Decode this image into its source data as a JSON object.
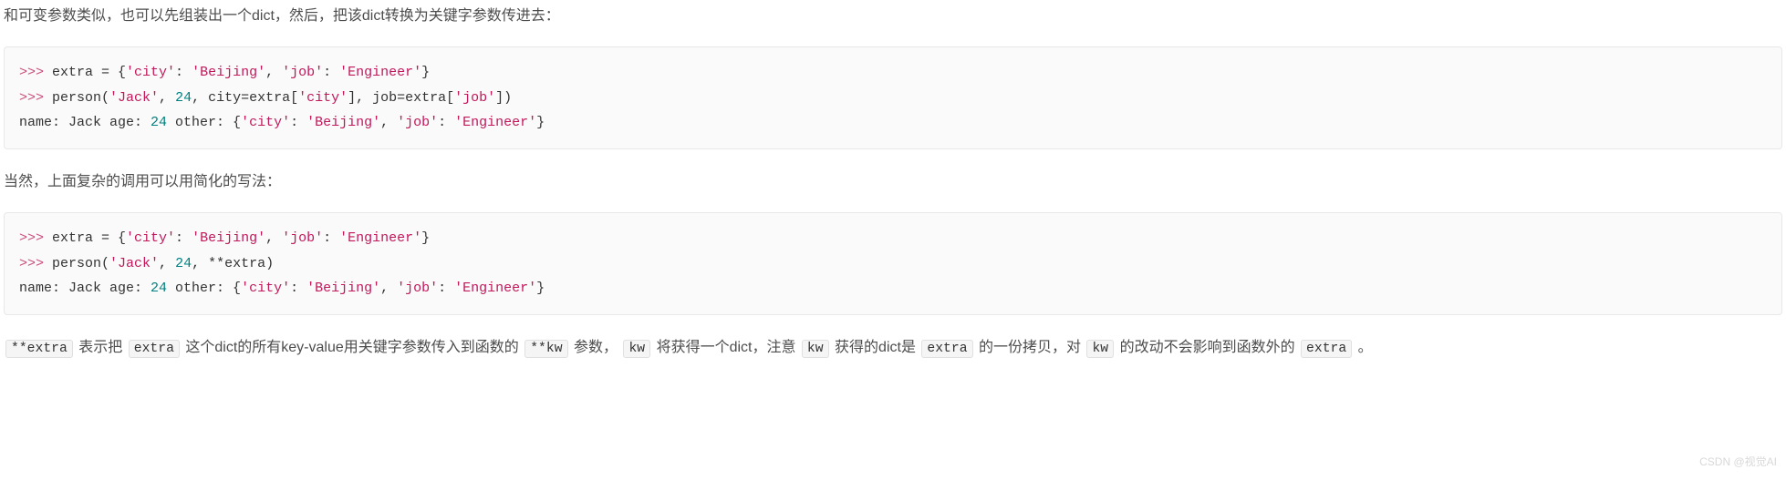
{
  "para1": "和可变参数类似，也可以先组装出一个dict，然后，把该dict转换为关键字参数传进去：",
  "para2": "当然，上面复杂的调用可以用简化的写法：",
  "code1": {
    "l1": {
      "prompt": ">>>",
      "t1": " extra = {",
      "s1": "'city'",
      "t2": ": ",
      "s2": "'Beijing'",
      "t3": ", ",
      "s3": "'job'",
      "t4": ": ",
      "s4": "'Engineer'",
      "t5": "}"
    },
    "l2": {
      "prompt": ">>>",
      "t1": " person(",
      "s1": "'Jack'",
      "t2": ", ",
      "n1": "24",
      "t3": ", city=extra[",
      "s2": "'city'",
      "t4": "], job=extra[",
      "s3": "'job'",
      "t5": "])"
    },
    "l3": {
      "t1": "name: Jack age: ",
      "n1": "24",
      "t2": " other: {",
      "s1": "'city'",
      "t3": ": ",
      "s2": "'Beijing'",
      "t4": ", ",
      "s3": "'job'",
      "t5": ": ",
      "s4": "'Engineer'",
      "t6": "}"
    }
  },
  "code2": {
    "l1": {
      "prompt": ">>>",
      "t1": " extra = {",
      "s1": "'city'",
      "t2": ": ",
      "s2": "'Beijing'",
      "t3": ", ",
      "s3": "'job'",
      "t4": ": ",
      "s4": "'Engineer'",
      "t5": "}"
    },
    "l2": {
      "prompt": ">>>",
      "t1": " person(",
      "s1": "'Jack'",
      "t2": ", ",
      "n1": "24",
      "t3": ", **extra)"
    },
    "l3": {
      "t1": "name: Jack age: ",
      "n1": "24",
      "t2": " other: {",
      "s1": "'city'",
      "t3": ": ",
      "s2": "'Beijing'",
      "t4": ", ",
      "s3": "'job'",
      "t5": ": ",
      "s4": "'Engineer'",
      "t6": "}"
    }
  },
  "para3": {
    "c1": "**extra",
    "t1": " 表示把 ",
    "c2": "extra",
    "t2": " 这个dict的所有key-value用关键字参数传入到函数的 ",
    "c3": "**kw",
    "t3": " 参数， ",
    "c4": "kw",
    "t4": " 将获得一个dict，注意 ",
    "c5": "kw",
    "t5": " 获得的dict是 ",
    "c6": "extra",
    "t6": " 的一份拷贝，对 ",
    "c7": "kw",
    "t7": " 的改动不会影响到函数外的 ",
    "c8": "extra",
    "t8": " 。"
  },
  "watermark": "CSDN @视觉AI"
}
